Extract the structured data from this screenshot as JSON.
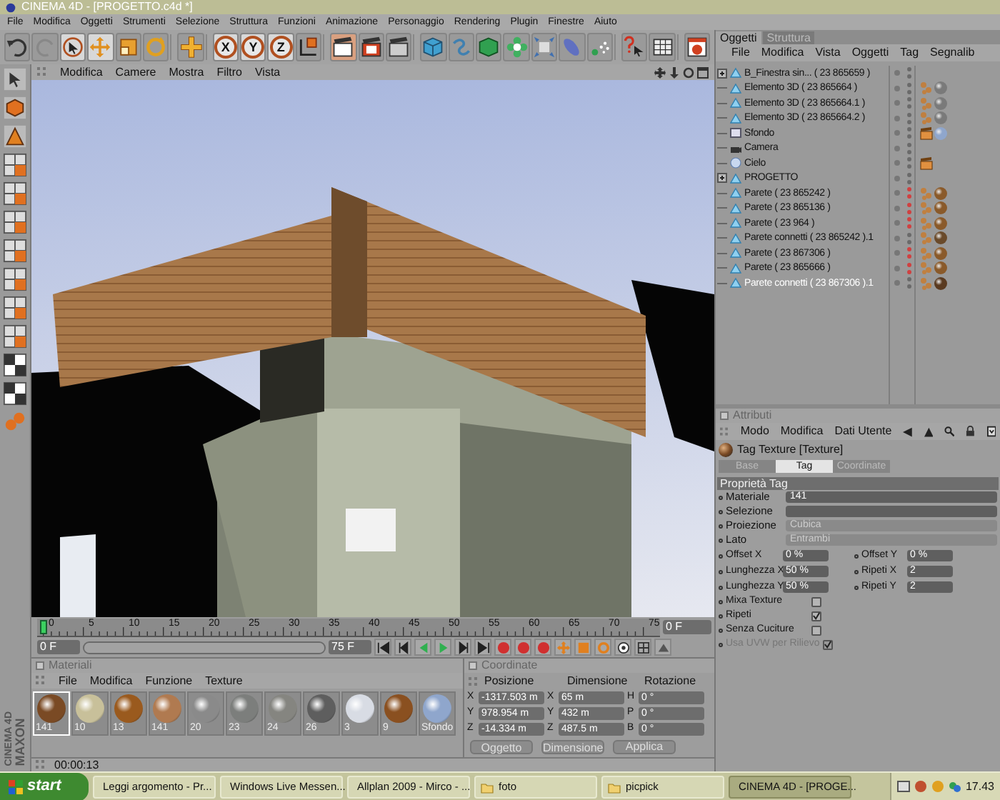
{
  "window": {
    "title": "CINEMA 4D - [PROGETTO.c4d *]"
  },
  "menu": [
    "File",
    "Modifica",
    "Oggetti",
    "Strumenti",
    "Selezione",
    "Struttura",
    "Funzioni",
    "Animazione",
    "Personaggio",
    "Rendering",
    "Plugin",
    "Finestre",
    "Aiuto"
  ],
  "toolbar": [
    {
      "kind": "undo",
      "selected": false
    },
    {
      "kind": "redo",
      "selected": false
    },
    {
      "kind": "select",
      "selected": true
    },
    {
      "kind": "move",
      "selected": true
    },
    {
      "kind": "scale",
      "selected": false
    },
    {
      "kind": "rotate",
      "selected": false
    },
    {
      "kind": "add",
      "selected": false
    },
    {
      "kind": "axis",
      "label": "X",
      "selected": true
    },
    {
      "kind": "axis",
      "label": "Y",
      "selected": true
    },
    {
      "kind": "axis",
      "label": "Z",
      "selected": true
    },
    {
      "kind": "coord",
      "selected": false
    },
    {
      "kind": "render-view",
      "selected": true
    },
    {
      "kind": "render-picture",
      "selected": false
    },
    {
      "kind": "render-settings",
      "selected": false
    },
    {
      "kind": "cube",
      "selected": false
    },
    {
      "kind": "spline",
      "selected": false
    },
    {
      "kind": "nurbs",
      "selected": false
    },
    {
      "kind": "flower",
      "selected": false
    },
    {
      "kind": "deformer",
      "selected": false
    },
    {
      "kind": "scene",
      "selected": false
    },
    {
      "kind": "particles",
      "selected": false
    },
    {
      "kind": "help",
      "selected": false
    },
    {
      "kind": "table",
      "selected": false
    },
    {
      "kind": "web",
      "selected": false
    }
  ],
  "viewport": {
    "menu": [
      "Modifica",
      "Camere",
      "Mostra",
      "Filtro",
      "Vista"
    ]
  },
  "timeline": {
    "ticks": [
      "0",
      "5",
      "10",
      "15",
      "20",
      "25",
      "30",
      "35",
      "40",
      "45",
      "50",
      "55",
      "60",
      "65",
      "70",
      "75"
    ],
    "level": 0,
    "preview_range": {
      "level": 1
    },
    "current": "0 F",
    "start": "0 F",
    "end": "75 F"
  },
  "materials": {
    "title": "Materiali",
    "menu": [
      "File",
      "Modifica",
      "Funzione",
      "Texture"
    ],
    "items": [
      {
        "label": "141",
        "color": "#7a4a24",
        "selected": true
      },
      {
        "label": "10",
        "color": "#c8c09a",
        "selected": false
      },
      {
        "label": "13",
        "color": "#9a5a1e",
        "selected": false
      },
      {
        "label": "141",
        "color": "#b07a50",
        "selected": false
      },
      {
        "label": "20",
        "color": "#8a8a8a",
        "selected": false
      },
      {
        "label": "23",
        "color": "#7c7e7c",
        "selected": false
      },
      {
        "label": "24",
        "color": "#858580",
        "selected": false
      },
      {
        "label": "26",
        "color": "#5e5e5e",
        "selected": false
      },
      {
        "label": "3",
        "color": "#d8dce4",
        "selected": false
      },
      {
        "label": "9",
        "color": "#8a5020",
        "selected": false
      },
      {
        "label": "Sfondo",
        "color": "#8fa6cc",
        "selected": false
      }
    ]
  },
  "coordinates": {
    "title": "Coordinate",
    "headings": [
      "Posizione",
      "Dimensione",
      "Rotazione"
    ],
    "rows": [
      [
        "X",
        "-1317.503 m",
        "X",
        "65 m",
        "H",
        "0 °"
      ],
      [
        "Y",
        "978.954 m",
        "Y",
        "432 m",
        "P",
        "0 °"
      ],
      [
        "Z",
        "-14.334 m",
        "Z",
        "487.5 m",
        "B",
        "0 °"
      ]
    ],
    "dropdowns": [
      "Oggetto",
      "Dimensione"
    ],
    "apply": "Applica"
  },
  "status_bar": {
    "time": "00:00:13"
  },
  "logo": [
    "MAXON",
    "CINEMA 4D"
  ],
  "objects": {
    "tabs": [
      {
        "label": "Oggetti",
        "selected": true
      },
      {
        "label": "Struttura",
        "selected": false
      }
    ],
    "menu": [
      "File",
      "Modifica",
      "Vista",
      "Oggetti",
      "Tag",
      "Segnalib"
    ],
    "items": [
      {
        "name": "B_Finestra sin... ( 23 865659 )",
        "kind": "polygon",
        "collapsed": true,
        "hidden": false,
        "selected": false
      },
      {
        "name": "Elemento 3D ( 23 865664 )",
        "kind": "polygon",
        "collapsed": false,
        "hidden": false,
        "selected": false,
        "tags": [
          {
            "kind": "phong"
          },
          {
            "kind": "material",
            "color": "#7a7a7a"
          }
        ]
      },
      {
        "name": "Elemento 3D ( 23 865664.1 )",
        "kind": "polygon",
        "collapsed": false,
        "hidden": false,
        "selected": false,
        "tags": [
          {
            "kind": "phong"
          },
          {
            "kind": "material",
            "color": "#7a7a7a"
          }
        ]
      },
      {
        "name": "Elemento 3D ( 23 865664.2 )",
        "kind": "polygon",
        "collapsed": false,
        "hidden": false,
        "selected": false,
        "tags": [
          {
            "kind": "phong"
          },
          {
            "kind": "material",
            "color": "#7a7a7a"
          }
        ]
      },
      {
        "name": "Sfondo",
        "kind": "background",
        "collapsed": false,
        "hidden": false,
        "selected": false,
        "tags": [
          {
            "kind": "clapper"
          },
          {
            "kind": "material",
            "color": "#8fa6cc"
          }
        ]
      },
      {
        "name": "Camera",
        "kind": "camera",
        "collapsed": false,
        "hidden": false,
        "selected": false
      },
      {
        "name": "Cielo",
        "kind": "sky",
        "collapsed": false,
        "hidden": false,
        "selected": false,
        "tags": [
          {
            "kind": "clapper"
          }
        ]
      },
      {
        "name": "PROGETTO",
        "kind": "polygon",
        "collapsed": true,
        "hidden": false,
        "selected": false
      },
      {
        "name": "Parete ( 23 865242 )",
        "kind": "polygon",
        "collapsed": false,
        "hidden": true,
        "selected": false,
        "tags": [
          {
            "kind": "phong"
          },
          {
            "kind": "material",
            "color": "#8a5a2a"
          }
        ]
      },
      {
        "name": "Parete ( 23 865136 )",
        "kind": "polygon",
        "collapsed": false,
        "hidden": true,
        "selected": false,
        "tags": [
          {
            "kind": "phong"
          },
          {
            "kind": "material",
            "color": "#8a5a2a"
          }
        ]
      },
      {
        "name": "Parete ( 23 964 )",
        "kind": "polygon",
        "collapsed": false,
        "hidden": true,
        "selected": false,
        "tags": [
          {
            "kind": "phong"
          },
          {
            "kind": "material",
            "color": "#8a5a2a"
          }
        ]
      },
      {
        "name": "Parete connetti ( 23 865242 ).1",
        "kind": "polygon",
        "collapsed": false,
        "hidden": false,
        "selected": false,
        "tags": [
          {
            "kind": "phong"
          },
          {
            "kind": "material",
            "color": "#6a4a2a"
          }
        ]
      },
      {
        "name": "Parete ( 23 867306 )",
        "kind": "polygon",
        "collapsed": false,
        "hidden": true,
        "selected": false,
        "tags": [
          {
            "kind": "phong"
          },
          {
            "kind": "material",
            "color": "#8a5a2a"
          }
        ]
      },
      {
        "name": "Parete ( 23 865666 )",
        "kind": "polygon",
        "collapsed": false,
        "hidden": true,
        "selected": false,
        "tags": [
          {
            "kind": "phong"
          },
          {
            "kind": "material",
            "color": "#8a5a2a"
          }
        ]
      },
      {
        "name": "Parete connetti ( 23 867306 ).1",
        "kind": "polygon",
        "collapsed": false,
        "hidden": false,
        "selected": true,
        "tags": [
          {
            "kind": "phong"
          },
          {
            "kind": "material",
            "color": "#5a3a20"
          }
        ]
      }
    ]
  },
  "attributes": {
    "title": "Attributi",
    "menu": [
      "Modo",
      "Modifica",
      "Dati Utente"
    ],
    "heading": "Tag Texture [Texture]",
    "tabs": [
      {
        "label": "Base",
        "selected": false
      },
      {
        "label": "Tag",
        "selected": true
      },
      {
        "label": "Coordinate",
        "selected": false
      }
    ],
    "section": "Proprietà Tag",
    "rows": [
      {
        "kind": "link",
        "label": "Materiale",
        "value": "141"
      },
      {
        "kind": "link",
        "label": "Selezione"
      },
      {
        "kind": "dropdown",
        "label": "Proiezione",
        "value": "Cubica"
      },
      {
        "kind": "dropdown",
        "label": "Lato",
        "value": "Entrambi"
      },
      {
        "kind": "pair",
        "label": "Offset X",
        "value": "0 %",
        "label2": "Offset Y",
        "value2": "0 %"
      },
      {
        "kind": "pair",
        "label": "Lunghezza X",
        "value": "50 %",
        "label2": "Ripeti X",
        "value2": "2"
      },
      {
        "kind": "pair",
        "label": "Lunghezza Y",
        "value": "50 %",
        "label2": "Ripeti Y",
        "value2": "2"
      },
      {
        "kind": "checkbox",
        "label": "Mixa Texture",
        "checked": false,
        "disabled": false
      },
      {
        "kind": "checkbox",
        "label": "Ripeti",
        "checked": true,
        "disabled": false
      },
      {
        "kind": "checkbox",
        "label": "Senza Cuciture",
        "checked": false,
        "disabled": false
      },
      {
        "kind": "checkbox",
        "label": "Usa UVW per Rilievo",
        "checked": true,
        "disabled": true
      }
    ]
  },
  "taskbar": {
    "start": "start",
    "items": [
      {
        "label": "Leggi argomento - Pr...",
        "selected": false
      },
      {
        "label": "Windows Live Messen...",
        "selected": false
      },
      {
        "label": "Allplan 2009 - Mirco - ...",
        "selected": false
      },
      {
        "label": "foto",
        "selected": false
      },
      {
        "label": "picpick",
        "selected": false
      },
      {
        "label": "CINEMA 4D - [PROGE...",
        "selected": true
      }
    ],
    "clock": "17.43"
  }
}
